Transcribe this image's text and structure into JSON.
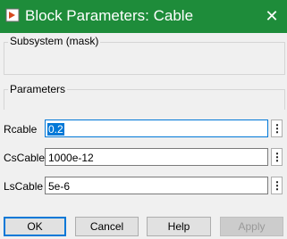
{
  "window": {
    "title": "Block Parameters: Cable",
    "icon": "simulink-block-icon",
    "close_icon": "close-icon"
  },
  "mask_group": {
    "label": "Subsystem (mask)"
  },
  "params_group": {
    "label": "Parameters"
  },
  "params": [
    {
      "label": "Rcable",
      "value": "0.2",
      "selected": true
    },
    {
      "label": "CsCable",
      "value": "1000e-12"
    },
    {
      "label": "LsCable",
      "value": "5e-6"
    }
  ],
  "buttons": {
    "ok": "OK",
    "cancel": "Cancel",
    "help": "Help",
    "apply": "Apply"
  },
  "colors": {
    "titlebar": "#1e8c3a",
    "focus": "#0078d7"
  }
}
